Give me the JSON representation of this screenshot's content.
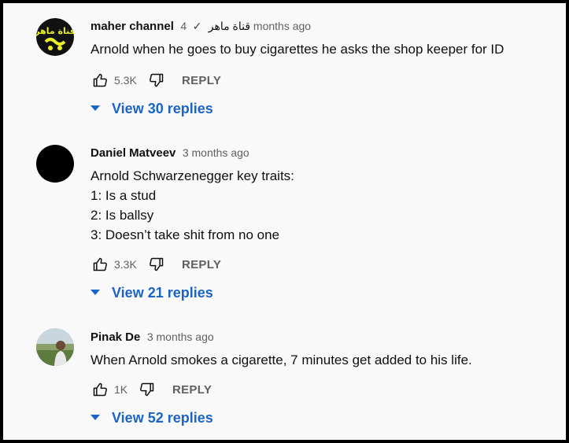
{
  "comments": [
    {
      "author": "maher channel",
      "author_extra": "قناة ماهر",
      "verified_mark": "✓",
      "time": "4 months ago",
      "lines": [
        "Arnold when he goes to buy cigarettes he asks the shop keeper for ID"
      ],
      "likes": "5.3K",
      "reply_label": "REPLY",
      "view_replies": "View 30 replies",
      "avatar_text": "قناة ماهر"
    },
    {
      "author": "Daniel Matveev",
      "time": "3 months ago",
      "lines": [
        "Arnold Schwarzenegger key traits:",
        "1: Is a stud",
        "2: Is ballsy",
        "3: Doesn’t take shit from no one"
      ],
      "likes": "3.3K",
      "reply_label": "REPLY",
      "view_replies": "View 21 replies"
    },
    {
      "author": "Pinak De",
      "time": "3 months ago",
      "lines": [
        "When Arnold smokes a cigarette, 7 minutes get added to his life."
      ],
      "likes": "1K",
      "reply_label": "REPLY",
      "view_replies": "View 52 replies"
    }
  ],
  "colors": {
    "background": "#f9f9f9",
    "border": "#000000",
    "link_blue": "#1a64c8",
    "meta_gray": "#606060"
  }
}
